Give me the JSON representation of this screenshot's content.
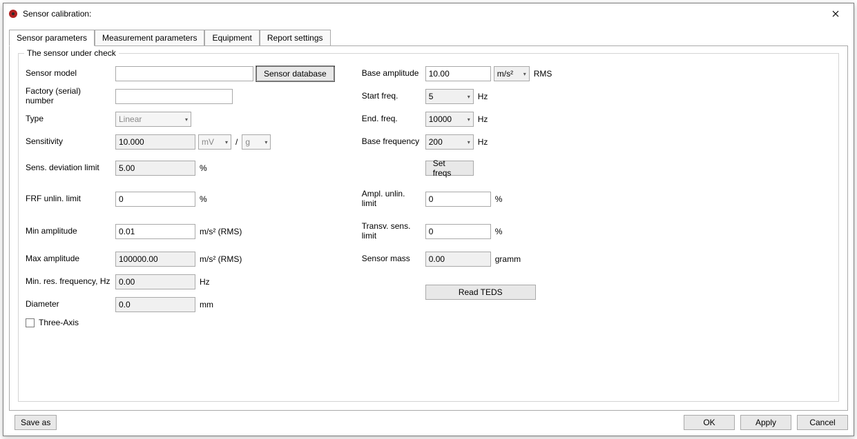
{
  "window": {
    "title": "Sensor calibration:"
  },
  "tabs": [
    {
      "label": "Sensor parameters"
    },
    {
      "label": "Measurement parameters"
    },
    {
      "label": "Equipment"
    },
    {
      "label": "Report settings"
    }
  ],
  "group": {
    "legend": "The sensor under check"
  },
  "labels": {
    "sensor_model": "Sensor model",
    "factory_number": "Factory (serial) number",
    "type": "Type",
    "sensitivity": "Sensitivity",
    "sens_deviation_limit": "Sens. deviation limit",
    "frf_unlin_limit": "FRF unlin. limit",
    "min_amplitude": "Min amplitude",
    "max_amplitude": "Max amplitude",
    "min_res_freq": "Min. res. frequency, Hz",
    "diameter": "Diameter",
    "three_axis": "Three-Axis",
    "base_amplitude": "Base amplitude",
    "start_freq": "Start freq.",
    "end_freq": "End. freq.",
    "base_freq": "Base frequency",
    "ampl_unlin_limit": "Ampl. unlin. limit",
    "transv_sens_limit": "Transv. sens. limit",
    "sensor_mass": "Sensor mass"
  },
  "values": {
    "sensor_model": "",
    "factory_number": "",
    "type": "Linear",
    "sensitivity": "10.000",
    "sensitivity_unit_num": "mV",
    "sensitivity_unit_den": "g",
    "sens_deviation_limit": "5.00",
    "frf_unlin_limit": "0",
    "min_amplitude": "0.01",
    "max_amplitude": "100000.00",
    "min_res_freq": "0.00",
    "diameter": "0.0",
    "base_amplitude": "10.00",
    "base_amplitude_unit": "m/s²",
    "start_freq": "5",
    "end_freq": "10000",
    "base_freq": "200",
    "ampl_unlin_limit": "0",
    "transv_sens_limit": "0",
    "sensor_mass": "0.00"
  },
  "units": {
    "percent": "%",
    "ms2_rms": "m/s² (RMS)",
    "hz": "Hz",
    "mm": "mm",
    "rms": "RMS",
    "gramm": "gramm",
    "slash": "/"
  },
  "buttons": {
    "sensor_database": "Sensor database",
    "set_freqs": "Set freqs",
    "read_teds": "Read TEDS",
    "save_as": "Save as",
    "ok": "OK",
    "apply": "Apply",
    "cancel": "Cancel"
  }
}
